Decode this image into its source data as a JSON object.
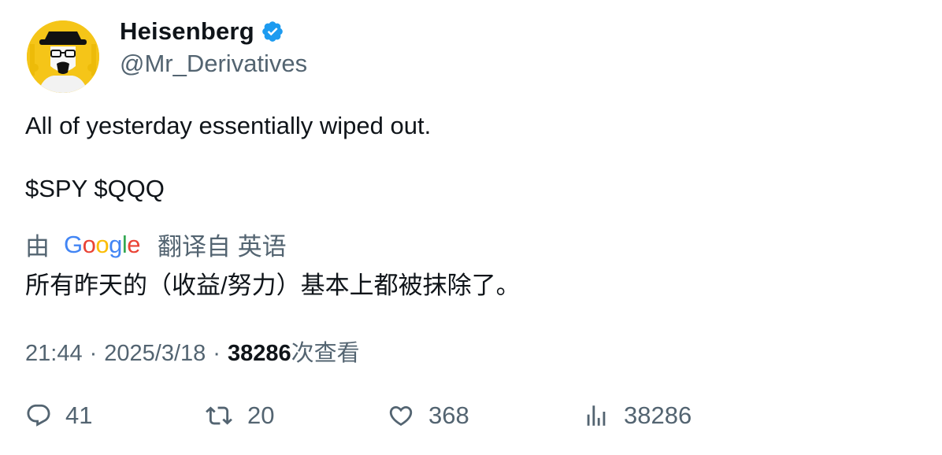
{
  "author": {
    "name": "Heisenberg",
    "handle": "@Mr_Derivatives",
    "verified": true,
    "verified_color": "#1d9bf0",
    "avatar_icon": "heisenberg-avatar-icon"
  },
  "tweet": {
    "text_line1": "All of yesterday essentially wiped out.",
    "text_line2": "$SPY $QQQ"
  },
  "translation": {
    "prefix": "由",
    "provider_letters": [
      "G",
      "o",
      "o",
      "g",
      "l",
      "e"
    ],
    "suffix": "翻译自 英语",
    "translated_text": "所有昨天的（收益/努力）基本上都被抹除了。"
  },
  "meta": {
    "time": "21:44",
    "separator": "·",
    "date": "2025/3/18",
    "views_count": "38286",
    "views_label": "次查看"
  },
  "actions": {
    "replies": "41",
    "retweets": "20",
    "likes": "368",
    "views": "38286"
  },
  "colors": {
    "text": "#0f1419",
    "secondary": "#536471",
    "avatar_bg": "#f5c518"
  }
}
